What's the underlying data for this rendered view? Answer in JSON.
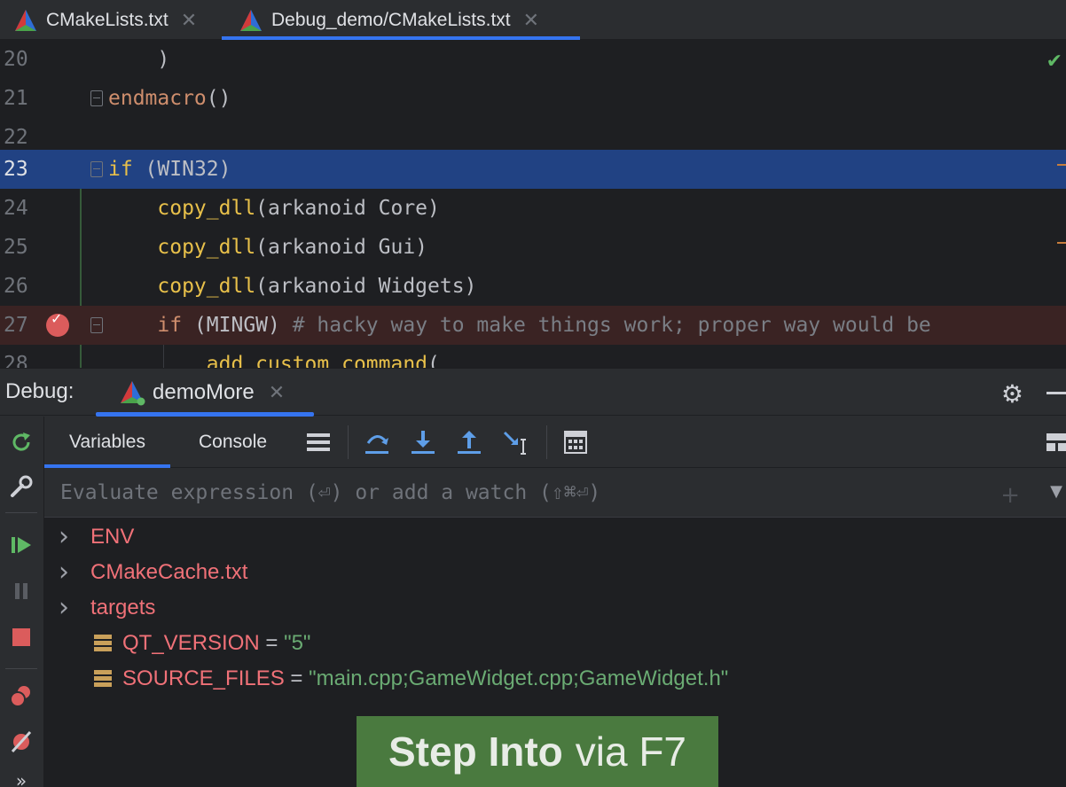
{
  "tabs": [
    {
      "label": "CMakeLists.txt",
      "active": false
    },
    {
      "label": "Debug_demo/CMakeLists.txt",
      "active": true
    }
  ],
  "editor": {
    "lines": [
      {
        "num": "20",
        "parts": [
          {
            "t": "    )",
            "c": "plain"
          }
        ]
      },
      {
        "num": "21",
        "parts": [
          {
            "t": "endmacro",
            "c": "kw"
          },
          {
            "t": "()",
            "c": "plain"
          }
        ]
      },
      {
        "num": "22",
        "parts": []
      },
      {
        "num": "23",
        "parts": [
          {
            "t": "if",
            "c": "kwy"
          },
          {
            "t": " (WIN32)",
            "c": "plain"
          }
        ]
      },
      {
        "num": "24",
        "parts": [
          {
            "t": "    ",
            "c": "plain"
          },
          {
            "t": "copy_dll",
            "c": "fn"
          },
          {
            "t": "(arkanoid Core)",
            "c": "plain"
          }
        ]
      },
      {
        "num": "25",
        "parts": [
          {
            "t": "    ",
            "c": "plain"
          },
          {
            "t": "copy_dll",
            "c": "fn"
          },
          {
            "t": "(arkanoid Gui)",
            "c": "plain"
          }
        ]
      },
      {
        "num": "26",
        "parts": [
          {
            "t": "    ",
            "c": "plain"
          },
          {
            "t": "copy_dll",
            "c": "fn"
          },
          {
            "t": "(arkanoid Widgets)",
            "c": "plain"
          }
        ]
      },
      {
        "num": "27",
        "parts": [
          {
            "t": "    ",
            "c": "plain"
          },
          {
            "t": "if",
            "c": "kw"
          },
          {
            "t": " (MINGW) ",
            "c": "plain"
          },
          {
            "t": "# hacky way to make things work; proper way would be",
            "c": "cm"
          }
        ]
      },
      {
        "num": "28",
        "parts": [
          {
            "t": "        ",
            "c": "plain"
          },
          {
            "t": "add_custom_command",
            "c": "fn"
          },
          {
            "t": "(",
            "c": "plain"
          }
        ]
      }
    ]
  },
  "debug": {
    "label": "Debug:",
    "session": "demoMore",
    "tabs": {
      "variables": "Variables",
      "console": "Console"
    },
    "eval_placeholder": "Evaluate expression (⏎) or add a watch (⇧⌘⏎)",
    "variables": [
      {
        "type": "group",
        "name": "ENV"
      },
      {
        "type": "group",
        "name": "CMakeCache.txt"
      },
      {
        "type": "group",
        "name": "targets"
      },
      {
        "type": "field",
        "name": "QT_VERSION",
        "eq": " = ",
        "value": "\"5\""
      },
      {
        "type": "field",
        "name": "SOURCE_FILES",
        "eq": " = ",
        "value": "\"main.cpp;GameWidget.cpp;GameWidget.h\""
      }
    ],
    "hint": {
      "bold": "Step Into",
      "rest": "via F7"
    }
  },
  "colors": {
    "accent": "#3574f0",
    "current_line": "#214283",
    "breakpoint": "#db5c5c",
    "hint_bg": "#4a7a3f"
  }
}
